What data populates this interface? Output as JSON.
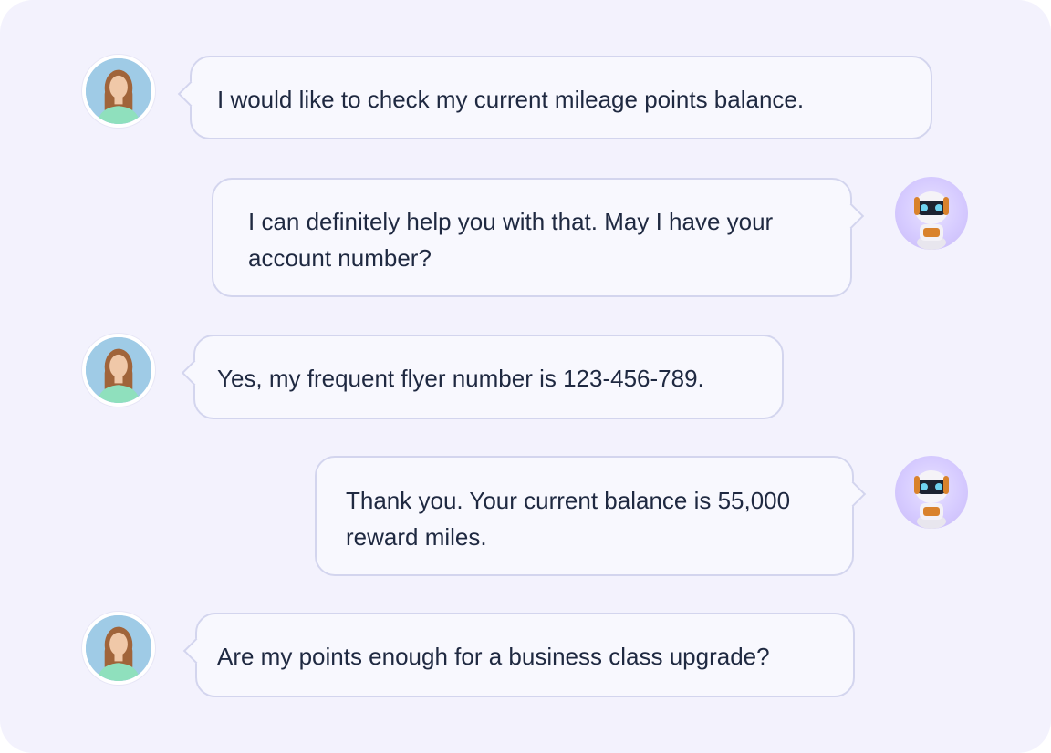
{
  "conversation": {
    "messages": [
      {
        "sender": "user",
        "text": "I would like to check my current mileage points balance."
      },
      {
        "sender": "bot",
        "text": "I can definitely help you with that. May I have your account number?"
      },
      {
        "sender": "user",
        "text": "Yes, my frequent flyer number is 123-456-789."
      },
      {
        "sender": "bot",
        "text": "Thank you. Your current balance is 55,000 reward miles."
      },
      {
        "sender": "user",
        "text": "Are my points enough for a business class upgrade?"
      }
    ]
  },
  "colors": {
    "panel_background": "#f3f2fd",
    "bubble_background": "#f8f8fe",
    "bubble_border": "#d3d5ee",
    "text": "#1f2941",
    "bot_avatar_background": "#d6cbff"
  }
}
